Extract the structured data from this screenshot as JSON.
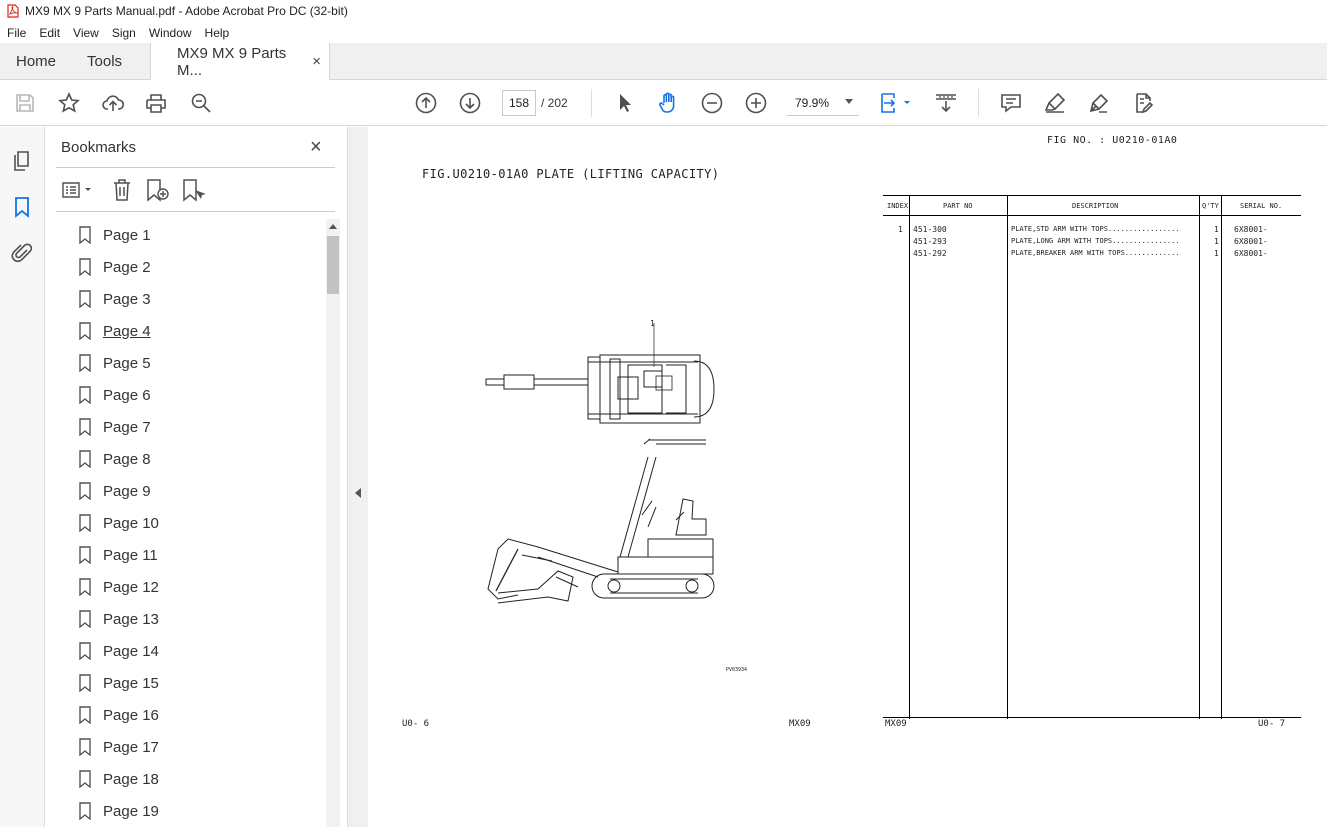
{
  "window": {
    "title": "MX9 MX 9 Parts Manual.pdf - Adobe Acrobat Pro DC (32-bit)"
  },
  "menu": [
    "File",
    "Edit",
    "View",
    "Sign",
    "Window",
    "Help"
  ],
  "tabs": {
    "home": "Home",
    "tools": "Tools",
    "document": "MX9 MX 9 Parts M...",
    "close": "×"
  },
  "toolbar": {
    "current_page": "158",
    "total_pages": "/ 202",
    "zoom": "79.9%"
  },
  "bookmarks": {
    "title": "Bookmarks",
    "close": "×",
    "items": [
      "Page 1",
      "Page 2",
      "Page 3",
      "Page 4",
      "Page 5",
      "Page 6",
      "Page 7",
      "Page 8",
      "Page 9",
      "Page 10",
      "Page 11",
      "Page 12",
      "Page 13",
      "Page 14",
      "Page 15",
      "Page 16",
      "Page 17",
      "Page 18",
      "Page 19"
    ],
    "hovered_index": 3
  },
  "document": {
    "fig_no": "FIG NO. : U0210-01A0",
    "fig_title": "FIG.U0210-01A0  PLATE (LIFTING CAPACITY)",
    "callout": "1",
    "drawing_code": "PV03934",
    "footer_left_page": "U0-   6",
    "footer_left_model": "MX09",
    "footer_right_model": "MX09",
    "footer_right_page": "U0-   7",
    "table": {
      "headers": {
        "index": "INDEX",
        "part_no": "PART NO",
        "description": "DESCRIPTION",
        "qty": "Q'TY",
        "serial": "SERIAL NO."
      },
      "rows": [
        {
          "index": "1",
          "part_no": "451-300",
          "description": "PLATE,STD ARM WITH TOPS.................",
          "qty": "1",
          "serial": "6X8001-"
        },
        {
          "index": "",
          "part_no": "451-293",
          "description": "PLATE,LONG ARM WITH TOPS................",
          "qty": "1",
          "serial": "6X8001-"
        },
        {
          "index": "",
          "part_no": "451-292",
          "description": "PLATE,BREAKER ARM WITH TOPS.............",
          "qty": "1",
          "serial": "6X8001-"
        }
      ]
    }
  },
  "colors": {
    "acrobat_red": "#d9261c",
    "accent_blue": "#1473e6",
    "icon_gray": "#505050"
  }
}
